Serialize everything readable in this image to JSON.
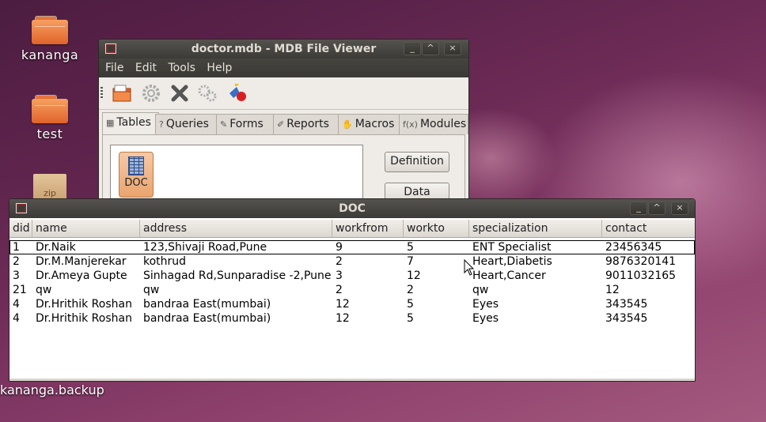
{
  "desktop": {
    "icons": [
      {
        "label": "kananga",
        "kind": "folder"
      },
      {
        "label": "test",
        "kind": "folder"
      },
      {
        "label": "zip",
        "kind": "archive"
      }
    ],
    "fragment_label": "kananga.backup"
  },
  "mdb_window": {
    "title": "doctor.mdb - MDB File Viewer",
    "menu": [
      "File",
      "Edit",
      "Tools",
      "Help"
    ],
    "toolbar": [
      "open-icon",
      "properties-icon",
      "delete-icon",
      "settings-icon",
      "run-icon"
    ],
    "tabs": [
      {
        "label": "Tables",
        "icon": "table-icon"
      },
      {
        "label": "Queries",
        "icon": "query-icon"
      },
      {
        "label": "Forms",
        "icon": "form-icon"
      },
      {
        "label": "Reports",
        "icon": "report-icon"
      },
      {
        "label": "Macros",
        "icon": "macro-icon"
      },
      {
        "label": "Modules",
        "icon": "module-icon"
      }
    ],
    "active_tab": "Tables",
    "tables": [
      "DOC"
    ],
    "buttons": {
      "definition": "Definition",
      "data": "Data"
    }
  },
  "doc_window": {
    "title": "DOC",
    "columns": [
      "did",
      "name",
      "address",
      "workfrom",
      "workto",
      "specialization",
      "contact"
    ],
    "rows": [
      [
        "1",
        "Dr.Naik",
        "123,Shivaji Road,Pune",
        "9",
        "5",
        "ENT Specialist",
        "23456345"
      ],
      [
        "2",
        "Dr.M.Manjerekar",
        "kothrud",
        "2",
        "7",
        "Heart,Diabetis",
        "9876320141"
      ],
      [
        "3",
        "Dr.Ameya Gupte",
        "Sinhagad Rd,Sunparadise -2,Pune",
        "3",
        "12",
        "Heart,Cancer",
        "9011032165"
      ],
      [
        "21",
        "qw",
        "qw",
        "2",
        "2",
        "qw",
        "12"
      ],
      [
        "4",
        "Dr.Hrithik Roshan",
        "bandraa East(mumbai)",
        "12",
        "5",
        "Eyes",
        "343545"
      ],
      [
        "4",
        "Dr.Hrithik Roshan",
        "bandraa East(mumbai)",
        "12",
        "5",
        "Eyes",
        "343545"
      ]
    ],
    "selected_row": 0
  },
  "window_controls": {
    "minimize": "_",
    "maximize": "^",
    "close": "×"
  }
}
